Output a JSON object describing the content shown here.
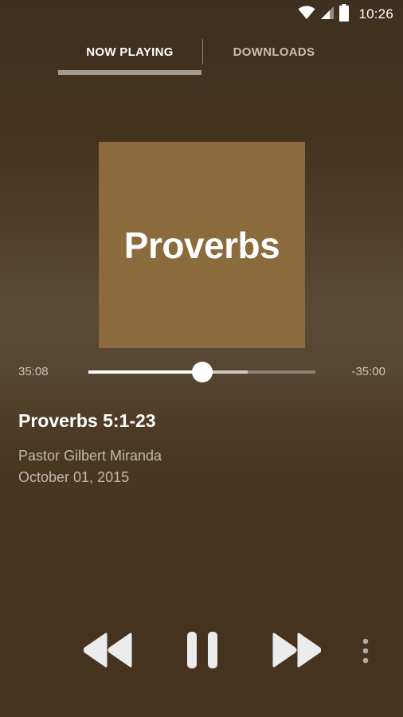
{
  "status_bar": {
    "time": "10:26",
    "icons": [
      "wifi-icon",
      "cell-signal-icon",
      "battery-icon"
    ]
  },
  "tabs": [
    {
      "label": "NOW PLAYING",
      "selected": true
    },
    {
      "label": "DOWNLOADS",
      "selected": false
    }
  ],
  "artwork": {
    "title": "Proverbs",
    "background_color": "#8b6a3b"
  },
  "player": {
    "elapsed": "35:08",
    "remaining": "-35:00",
    "progress": 0.5,
    "buffered": 0.7
  },
  "track": {
    "title": "Proverbs 5:1-23",
    "speaker": "Pastor Gilbert Miranda",
    "date": "October 01, 2015"
  },
  "controls": [
    "rewind-icon",
    "pause-icon",
    "fast-forward-icon",
    "more-vert-icon"
  ],
  "colors": {
    "background": "#45331f",
    "accent": "#8b6a3b",
    "text_primary": "#ffffff",
    "text_secondary": "#c2b8ab"
  }
}
